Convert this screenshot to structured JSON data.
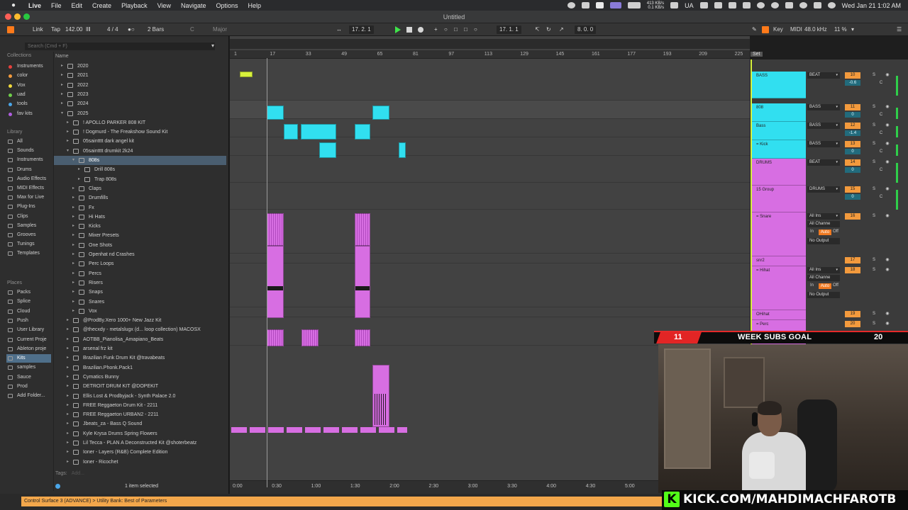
{
  "menubar": {
    "items": [
      "Live",
      "File",
      "Edit",
      "Create",
      "Playback",
      "View",
      "Navigate",
      "Options",
      "Help"
    ],
    "network_up": "413 KB/s",
    "network_down": "0.1 KB/s",
    "keyboard_layout": "UA",
    "clock": "Wed Jan 21  1:02 AM"
  },
  "window": {
    "title": "Untitled"
  },
  "control_bar": {
    "link": "Link",
    "tap": "Tap",
    "tempo": "142.00",
    "time_signature": "4 / 4",
    "quantize": "2 Bars",
    "key_root": "C",
    "scale": "Major",
    "arrangement_position": "17.  2.  1",
    "loop_start": "17.  1.  1",
    "loop_length": "8.  0.  0",
    "key": "Key",
    "midi": "MIDI",
    "sample_rate": "48.0 kHz",
    "cpu": "11 %"
  },
  "browser": {
    "search_placeholder": "Search (Cmd + F)",
    "column_name": "Name",
    "collections_heading": "Collections",
    "collections": [
      {
        "label": "Instruments",
        "color": "#e8413c"
      },
      {
        "label": "color",
        "color": "#f39a3d"
      },
      {
        "label": "Vox",
        "color": "#f1d93c"
      },
      {
        "label": "uad",
        "color": "#6fcf4a"
      },
      {
        "label": "tools",
        "color": "#4aa6e8"
      },
      {
        "label": "fav kits",
        "color": "#b05ee0"
      }
    ],
    "library_heading": "Library",
    "library": [
      "All",
      "Sounds",
      "Instruments",
      "Drums",
      "Audio Effects",
      "MIDI Effects",
      "Max for Live",
      "Plug-Ins",
      "Clips",
      "Samples",
      "Grooves",
      "Tunings",
      "Templates"
    ],
    "places_heading": "Places",
    "places": [
      "Packs",
      "Splice",
      "Cloud",
      "Push",
      "User Library",
      "Current Proje",
      "Ableton proje",
      "Kits",
      "samples",
      "Sauce",
      "Prod",
      "Add Folder..."
    ],
    "selected_place": "Kits",
    "tree": [
      {
        "label": "2020",
        "depth": 0,
        "expanded": false
      },
      {
        "label": "2021",
        "depth": 0,
        "expanded": false
      },
      {
        "label": "2022",
        "depth": 0,
        "expanded": false
      },
      {
        "label": "2023",
        "depth": 0,
        "expanded": false
      },
      {
        "label": "2024",
        "depth": 0,
        "expanded": false
      },
      {
        "label": "2025",
        "depth": 0,
        "expanded": true
      },
      {
        "label": "! APOLLO PARKER 808 KIT",
        "depth": 1,
        "expanded": false
      },
      {
        "label": "! Dogmurd - The Freakshow Sound Kit",
        "depth": 1,
        "expanded": false
      },
      {
        "label": "05saintttt dark angel kit",
        "depth": 1,
        "expanded": false
      },
      {
        "label": "05saintttt drumkit 2k24",
        "depth": 1,
        "expanded": true
      },
      {
        "label": "808s",
        "depth": 2,
        "expanded": true,
        "selected": true
      },
      {
        "label": "Drill 808s",
        "depth": 3,
        "expanded": false
      },
      {
        "label": "Trap 808s",
        "depth": 3,
        "expanded": false
      },
      {
        "label": "Claps",
        "depth": 2,
        "expanded": false
      },
      {
        "label": "Drumfills",
        "depth": 2,
        "expanded": false
      },
      {
        "label": "Fx",
        "depth": 2,
        "expanded": false
      },
      {
        "label": "Hi Hats",
        "depth": 2,
        "expanded": false
      },
      {
        "label": "Kicks",
        "depth": 2,
        "expanded": false
      },
      {
        "label": "Mixer Presets",
        "depth": 2,
        "expanded": false
      },
      {
        "label": "One Shots",
        "depth": 2,
        "expanded": false
      },
      {
        "label": "Openhat nd Crashes",
        "depth": 2,
        "expanded": false
      },
      {
        "label": "Perc Loops",
        "depth": 2,
        "expanded": false
      },
      {
        "label": "Percs",
        "depth": 2,
        "expanded": false
      },
      {
        "label": "Risers",
        "depth": 2,
        "expanded": false
      },
      {
        "label": "Snaps",
        "depth": 2,
        "expanded": false
      },
      {
        "label": "Snares",
        "depth": 2,
        "expanded": false
      },
      {
        "label": "Vox",
        "depth": 2,
        "expanded": false
      },
      {
        "label": "@ProdBy.Xero 1000+ New Jazz Kit",
        "depth": 1,
        "expanded": false
      },
      {
        "label": "@thecxdy - metalslugx (d... loop collection) MACOSX",
        "depth": 1,
        "expanded": false
      },
      {
        "label": "AOTBB_Pianolisa_Amapiano_Beats",
        "depth": 1,
        "expanded": false
      },
      {
        "label": "arsenal frz kit",
        "depth": 1,
        "expanded": false
      },
      {
        "label": "Brazilian Funk Drum Kit @travabeats",
        "depth": 1,
        "expanded": false
      },
      {
        "label": "Brazilian.Phonk.Pack1",
        "depth": 1,
        "expanded": false
      },
      {
        "label": "Cymatics Bunny",
        "depth": 1,
        "expanded": false
      },
      {
        "label": "DETROIT DRUM KIT @DOPEKIT",
        "depth": 1,
        "expanded": false
      },
      {
        "label": "Ellis Lost & Prodbyjack - Synth Palace 2.0",
        "depth": 1,
        "expanded": false
      },
      {
        "label": "FREE Reggaeton Drum Kit - 2211",
        "depth": 1,
        "expanded": false
      },
      {
        "label": "FREE Reggaeton URBAN2 - 2211",
        "depth": 1,
        "expanded": false
      },
      {
        "label": "Jbeats_za - Bass Q Sound",
        "depth": 1,
        "expanded": false
      },
      {
        "label": "Kyle Krysa Drums Spring Flowers",
        "depth": 1,
        "expanded": false
      },
      {
        "label": "Lil Tecca - PLAN A Deconstructed Kit @shoterbeatz",
        "depth": 1,
        "expanded": false
      },
      {
        "label": "Ioner - Layers (R&B) Complete Edition",
        "depth": 1,
        "expanded": false
      },
      {
        "label": "Ioner - Ricochet",
        "depth": 1,
        "expanded": false
      }
    ],
    "tags_label": "Tags:",
    "tags_add": "Add...",
    "selection_info": "1 item selected"
  },
  "arrangement": {
    "bar_markers": [
      "1",
      "17",
      "33",
      "49",
      "65",
      "81",
      "97",
      "113",
      "129",
      "145",
      "161",
      "177",
      "193",
      "209",
      "225"
    ],
    "time_markers": [
      "0:00",
      "0:30",
      "1:00",
      "1:30",
      "2:00",
      "2:30",
      "3:00",
      "3:30",
      "4:00",
      "4:30",
      "5:00"
    ],
    "set_button": "Set"
  },
  "tracks": [
    {
      "name": "BASS",
      "type": "group",
      "color": "#31dff0",
      "input": "BEAT",
      "number": "10",
      "volume": "-0.6",
      "pan": "C"
    },
    {
      "name": "808",
      "type": "group",
      "color": "#31dff0",
      "input": "BASS",
      "number": "11",
      "volume": "0",
      "pan": "C"
    },
    {
      "name": "Bass",
      "type": "group",
      "color": "#31dff0",
      "input": "BASS",
      "number": "12",
      "volume": "-1.4",
      "pan": "C"
    },
    {
      "name": "= Kick",
      "type": "group",
      "color": "#31dff0",
      "input": "BASS",
      "number": "13",
      "volume": "0",
      "pan": "C"
    },
    {
      "name": "DRUMS",
      "type": "group",
      "color": "#d76ee2",
      "input": "BEAT",
      "number": "14",
      "volume": "0",
      "pan": "C"
    },
    {
      "name": "15 Group",
      "type": "group",
      "color": "#d76ee2",
      "input": "DRUMS",
      "number": "15",
      "volume": "0",
      "pan": "C"
    },
    {
      "name": "= Snare",
      "type": "audio",
      "color": "#d76ee2",
      "input": "All Ins",
      "channel": "All Channe",
      "monitor_in": "In",
      "monitor_auto": "Auto",
      "monitor_off": "Off",
      "output": "No Output",
      "number": "16"
    },
    {
      "name": "snr2",
      "type": "audio",
      "color": "#d76ee2",
      "number": "17"
    },
    {
      "name": "= Hihat",
      "type": "audio",
      "color": "#d76ee2",
      "input": "All Ins",
      "channel": "All Channe",
      "monitor_in": "In",
      "monitor_auto": "Auto",
      "monitor_off": "Off",
      "output": "No Output",
      "number": "18"
    },
    {
      "name": "OHihat",
      "type": "audio",
      "color": "#d76ee2",
      "number": "19"
    },
    {
      "name": "= Perc",
      "type": "audio",
      "color": "#d76ee2",
      "number": "20"
    }
  ],
  "overlay": {
    "subs_current": "11",
    "subs_label": "WEEK SUBS GOAL",
    "subs_goal": "20",
    "kick_logo": "K",
    "kick_url": "KICK.COM/MAHDIMACHFAROTB"
  },
  "status_bar": {
    "message": "Control Surface 3 (ADVANCE) > Utility Bank: Best of Parameters"
  },
  "colors": {
    "bass_clip": "#31dff0",
    "drum_clip": "#d76ee2",
    "marker_clip": "#d7f13c",
    "accent_orange": "#f39a3d",
    "play_green": "#3fe34a",
    "kick_green": "#53fc18"
  }
}
